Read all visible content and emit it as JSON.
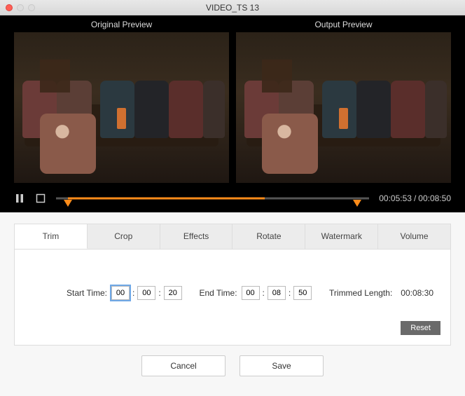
{
  "window": {
    "title": "VIDEO_TS 13"
  },
  "preview": {
    "original_label": "Original Preview",
    "output_label": "Output  Preview"
  },
  "playback": {
    "current_time": "00:05:53",
    "total_time": "00:08:50",
    "progress_pct": 66.7,
    "trim_start_pct": 3.8,
    "trim_end_pct": 96.2
  },
  "tabs": {
    "items": [
      {
        "label": "Trim",
        "active": true
      },
      {
        "label": "Crop",
        "active": false
      },
      {
        "label": "Effects",
        "active": false
      },
      {
        "label": "Rotate",
        "active": false
      },
      {
        "label": "Watermark",
        "active": false
      },
      {
        "label": "Volume",
        "active": false
      }
    ]
  },
  "trim": {
    "start_label": "Start Time:",
    "start": {
      "hh": "00",
      "mm": "00",
      "ss": "20"
    },
    "end_label": "End Time:",
    "end": {
      "hh": "00",
      "mm": "08",
      "ss": "50"
    },
    "length_label": "Trimmed Length:",
    "length_value": "00:08:30",
    "reset_label": "Reset"
  },
  "footer": {
    "cancel": "Cancel",
    "save": "Save"
  },
  "icons": {
    "pause": "pause-icon",
    "stop": "stop-icon"
  }
}
